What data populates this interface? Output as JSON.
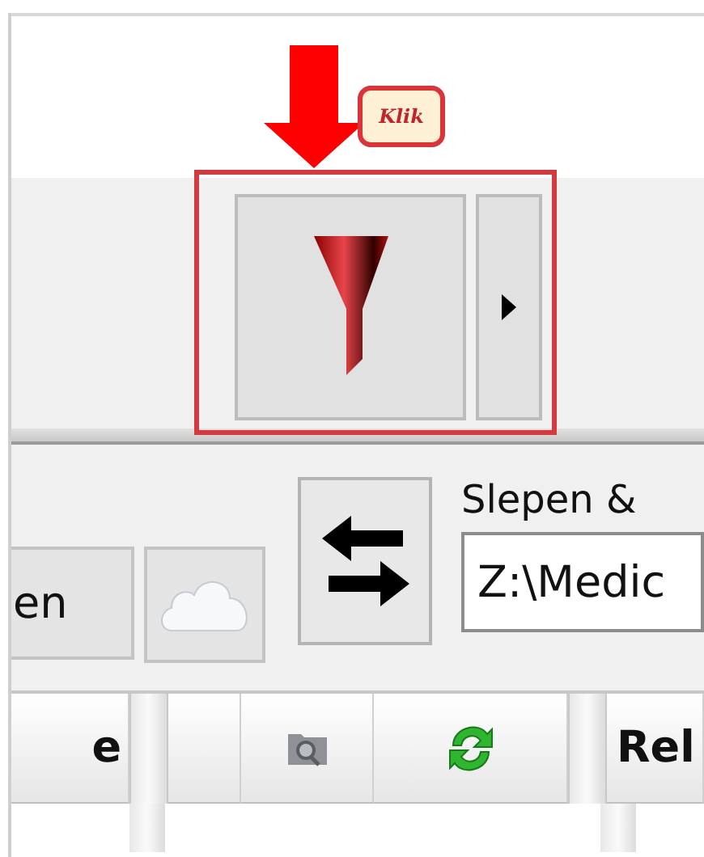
{
  "annotation": {
    "callout": "Klik"
  },
  "toolbar_2": {
    "button_1": "en",
    "swap_label": "Slepen &",
    "path_field": "Z:\\Medic"
  },
  "table": {
    "columns": [
      "e",
      "",
      "Rel"
    ]
  }
}
